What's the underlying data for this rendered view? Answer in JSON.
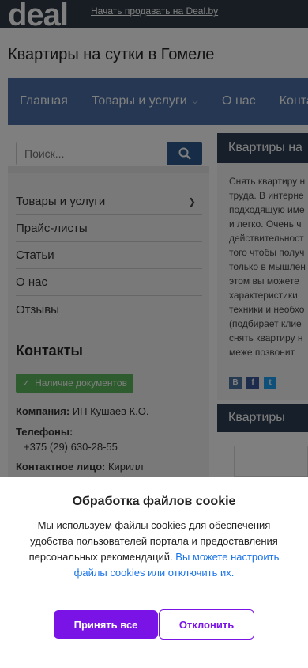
{
  "header": {
    "logo": "deal",
    "sell_link": "Начать продавать на Deal.by"
  },
  "page_title": "Квартиры на сутки в Гомеле",
  "nav": {
    "items": [
      {
        "label": "Главная"
      },
      {
        "label": "Товары и услуги"
      },
      {
        "label": "О нас"
      },
      {
        "label": "Конта"
      }
    ]
  },
  "search": {
    "placeholder": "Поиск..."
  },
  "sidebar": {
    "menu": [
      {
        "label": "Товары и услуги"
      },
      {
        "label": "Прайс-листы"
      },
      {
        "label": "Статьи"
      },
      {
        "label": "О нас"
      },
      {
        "label": "Отзывы"
      }
    ],
    "contacts_title": "Контакты",
    "documents_badge": "Наличие документов",
    "company_label": "Компания:",
    "company_value": "ИП Кушаев К.О.",
    "phones_label": "Телефоны:",
    "phone_value": "+375 (29) 630-28-55",
    "contact_label": "Контактное лицо:",
    "contact_value": "Кирилл"
  },
  "right_panel": {
    "heading": "Квартиры на",
    "text_lines": [
      "Снять квартиру н",
      "труда. В интерне",
      "подходящую име",
      "и легко. Очень ч",
      "действительност",
      "того чтобы получ",
      "только в мышлен",
      "этом вы можете",
      "характеристики",
      "техники и необхо",
      "(подбирает клие",
      "снять квартиру н",
      "меже позвонит"
    ],
    "share_icons": [
      "vk",
      "fb",
      "tw"
    ],
    "heading2": "Квартиры"
  },
  "cookie": {
    "title": "Обработка файлов cookie",
    "text": "Мы используем файлы cookies для обеспечения удобства пользователей портала и предоставления персональных рекомендаций.",
    "link": "Вы можете настроить файлы cookies или отключить их.",
    "accept_label": "Принять все",
    "decline_label": "Отклонить"
  },
  "colors": {
    "nav_bg": "#4a6fa5",
    "accent_purple": "#7a14e6",
    "link_blue": "#1a73e8",
    "badge_green": "#5cb85c"
  }
}
